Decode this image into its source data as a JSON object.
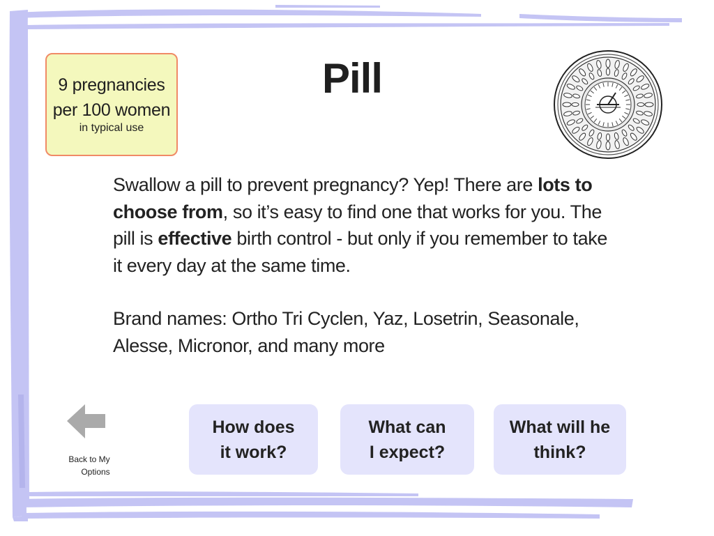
{
  "stat_box": {
    "line1": "9 pregnancies",
    "line2": "per 100 women",
    "line3": "in typical use"
  },
  "title": "Pill",
  "body": {
    "p1": {
      "part1": "Swallow a pill to prevent pregnancy? Yep! There are ",
      "bold1": "lots to choose from",
      "part2": ", so it’s easy to find one that works for you. The pill is ",
      "bold2": "effective",
      "part3": " birth control - but only if you remember to take it every day at the same time."
    },
    "p2": "Brand names: Ortho Tri Cyclen, Yaz, Losetrin, Seasonale, Alesse, Micronor, and many more"
  },
  "back": {
    "line1": "Back to My",
    "line2": "Options",
    "icon": "left-arrow-icon"
  },
  "nav_buttons": [
    {
      "line1": "How does",
      "line2": "it work?"
    },
    {
      "line1": "What can",
      "line2": "I expect?"
    },
    {
      "line1": "What will he",
      "line2": "think?"
    }
  ],
  "colors": {
    "frame": "#c4c4f4",
    "stat_bg": "#f4f8bd",
    "stat_border": "#f08a66",
    "button_bg": "#e4e4fc",
    "arrow": "#aaaaaa"
  }
}
